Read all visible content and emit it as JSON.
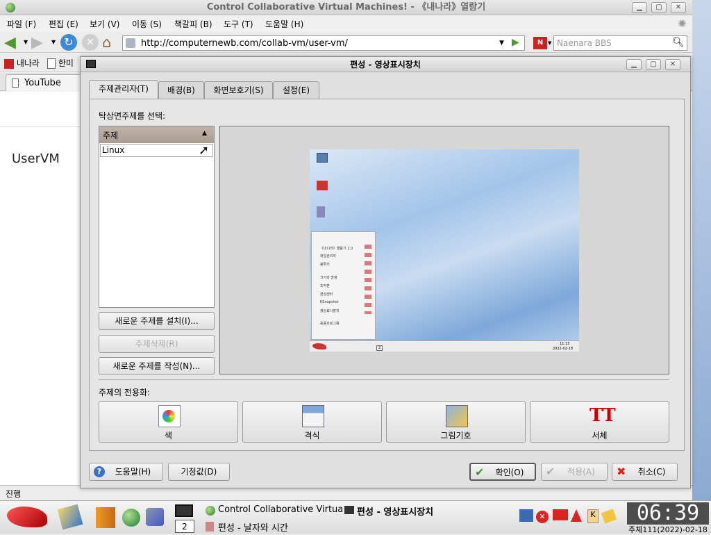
{
  "browser": {
    "title": "Control Collaborative Virtual Machines! - 《내나라》열람기",
    "menu": [
      "파일 (F)",
      "편집 (E)",
      "보기 (V)",
      "이동 (S)",
      "책갈피 (B)",
      "도구 (T)",
      "도움말 (H)"
    ],
    "url": "http://computernewb.com/collab-vm/user-vm/",
    "search_placeholder": "Naenara BBS",
    "bookmarks": [
      "내나라",
      "한미"
    ],
    "tab": "YouTube",
    "page_heading": "UserVM",
    "status": "진행"
  },
  "dialog": {
    "title": "편성 - 영상표시장치",
    "tabs": [
      "주제관리자(T)",
      "배경(B)",
      "화면보호기(S)",
      "설정(E)"
    ],
    "select_label": "탁상면주제를 선택:",
    "list_header": "주제",
    "list_items": [
      "Linux"
    ],
    "buttons": {
      "install": "새로운 주제를 설치(I)...",
      "delete": "주제삭제(R)",
      "create": "새로운 주제를 작성(N)..."
    },
    "customize_label": "주제의 전용화:",
    "custom": [
      "색",
      "격식",
      "그림기호",
      "서체"
    ],
    "help": "도움말(H)",
    "defaults": "기정값(D)",
    "ok": "확인(O)",
    "apply": "적용(A)",
    "cancel": "취소(C)",
    "preview": {
      "clock": "11:15",
      "date": "2022-02-18",
      "menu_items": [
        "《내나라》열람기 2.0",
        "파일관리자",
        "봉투리",
        "크기와 방향",
        "조작판",
        "편성센터",
        "KSnapshot",
        "영상표시장치",
        "응용프로그람"
      ],
      "taskbar_num": "2"
    }
  },
  "taskbar": {
    "task1": "Control Collaborative Virtua",
    "task2": "편성 - 영상표시장치",
    "task3": "편성 - 날자와 시간",
    "desktop_num": "2",
    "clock": "06:39",
    "date": "주체111(2022)-02-18"
  }
}
